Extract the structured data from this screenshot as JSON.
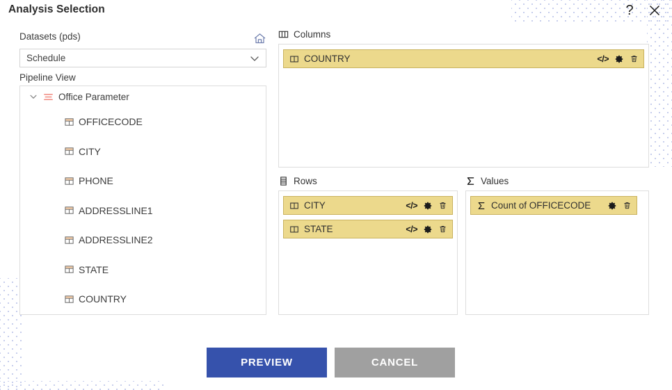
{
  "dialog": {
    "title": "Analysis Selection",
    "help_icon": "question-mark-icon",
    "help_label": "?",
    "close_icon": "close-icon"
  },
  "left": {
    "datasets_label": "Datasets (pds)",
    "home_icon": "home-icon",
    "dataset_select": {
      "value": "Schedule",
      "placeholder": "Select dataset",
      "chevron_icon": "chevron-down-icon"
    },
    "pipeline_label": "Pipeline View",
    "tree": {
      "root": {
        "label": "Office Parameter",
        "caret_icon": "chevron-down-icon",
        "node_icon": "pipeline-lines-icon",
        "node_icon_color": "#f08a80",
        "expanded": true
      },
      "children": [
        {
          "label": "OFFICECODE",
          "icon": "field-table-icon"
        },
        {
          "label": "CITY",
          "icon": "field-table-icon"
        },
        {
          "label": "PHONE",
          "icon": "field-table-icon"
        },
        {
          "label": "ADDRESSLINE1",
          "icon": "field-table-icon"
        },
        {
          "label": "ADDRESSLINE2",
          "icon": "field-table-icon"
        },
        {
          "label": "STATE",
          "icon": "field-table-icon"
        },
        {
          "label": "COUNTRY",
          "icon": "field-table-icon"
        }
      ]
    }
  },
  "panels": {
    "columns": {
      "title": "Columns",
      "icon": "columns-icon",
      "chips": [
        {
          "label": "COUNTRY",
          "icon": "column-field-icon",
          "actions": [
            "code-icon",
            "gear-icon",
            "trash-icon"
          ],
          "code_label": "</>"
        }
      ]
    },
    "rows": {
      "title": "Rows",
      "icon": "rows-icon",
      "chips": [
        {
          "label": "CITY",
          "icon": "column-field-icon",
          "actions": [
            "code-icon",
            "gear-icon",
            "trash-icon"
          ],
          "code_label": "</>"
        },
        {
          "label": "STATE",
          "icon": "column-field-icon",
          "actions": [
            "code-icon",
            "gear-icon",
            "trash-icon"
          ],
          "code_label": "</>"
        }
      ]
    },
    "values": {
      "title": "Values",
      "icon": "sigma-icon",
      "chips": [
        {
          "label": "Count of OFFICECODE",
          "icon": "sigma-icon",
          "actions": [
            "gear-icon",
            "trash-icon"
          ],
          "code_label": ""
        }
      ]
    }
  },
  "footer": {
    "preview_label": "PREVIEW",
    "cancel_label": "CANCEL"
  },
  "colors": {
    "chip_background": "#ecd98c",
    "chip_border": "#c9b25f",
    "primary_button": "#3652ac",
    "secondary_button": "#a0a0a0",
    "accent_node": "#f08a80",
    "dot_pattern": "#b9c2e8"
  }
}
